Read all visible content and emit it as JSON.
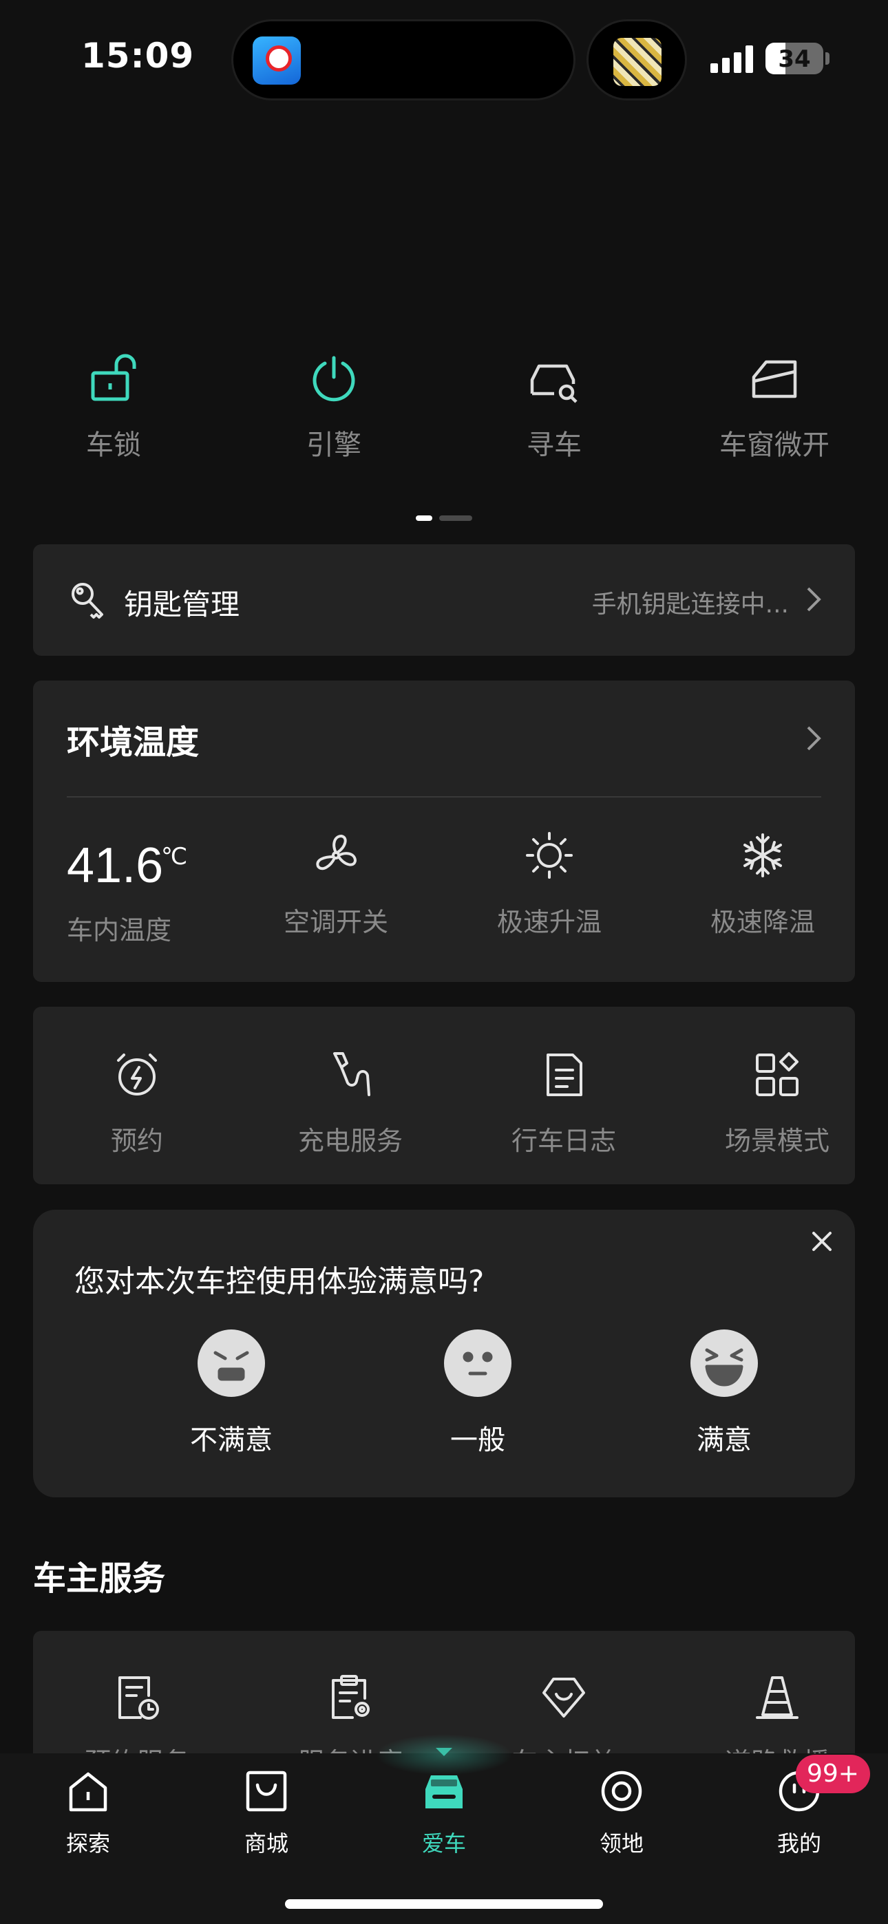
{
  "status_bar": {
    "time": "15:09",
    "battery": "34",
    "battery_level": 0.34
  },
  "quick_controls": [
    {
      "label": "车锁",
      "icon": "lock-open-icon",
      "active": true
    },
    {
      "label": "引擎",
      "icon": "power-icon",
      "active": true
    },
    {
      "label": "寻车",
      "icon": "find-car-icon",
      "active": false
    },
    {
      "label": "车窗微开",
      "icon": "window-icon",
      "active": false
    }
  ],
  "pager": {
    "pages": 2,
    "current": 1
  },
  "key_management": {
    "title": "钥匙管理",
    "status": "手机钥匙连接中..."
  },
  "environment": {
    "title": "环境温度",
    "temperature": "41.6",
    "unit": "℃",
    "temp_label": "车内温度",
    "actions": [
      {
        "label": "空调开关",
        "icon": "fan-icon"
      },
      {
        "label": "极速升温",
        "icon": "sun-icon"
      },
      {
        "label": "极速降温",
        "icon": "snowflake-icon"
      }
    ]
  },
  "functions": [
    {
      "label": "预约",
      "icon": "alarm-clock-icon"
    },
    {
      "label": "充电服务",
      "icon": "charger-icon"
    },
    {
      "label": "行车日志",
      "icon": "document-icon"
    },
    {
      "label": "场景模式",
      "icon": "grid-icon"
    }
  ],
  "survey": {
    "question": "您对本次车控使用体验满意吗?",
    "options": [
      {
        "label": "不满意",
        "icon": "angry-face-icon"
      },
      {
        "label": "一般",
        "icon": "neutral-face-icon"
      },
      {
        "label": "满意",
        "icon": "happy-face-icon"
      }
    ]
  },
  "owner_services": {
    "title": "车主服务",
    "items": [
      {
        "label": "预约服务",
        "icon": "appointment-icon"
      },
      {
        "label": "服务进度",
        "icon": "clipboard-icon"
      },
      {
        "label": "车主权益",
        "icon": "badge-icon"
      },
      {
        "label": "道路救援",
        "icon": "traffic-cone-icon"
      }
    ]
  },
  "tabbar": {
    "tabs": [
      {
        "label": "探索",
        "icon": "home-icon"
      },
      {
        "label": "商城",
        "icon": "shop-icon"
      },
      {
        "label": "爱车",
        "icon": "car-icon",
        "active": true
      },
      {
        "label": "领地",
        "icon": "target-icon"
      },
      {
        "label": "我的",
        "icon": "profile-icon"
      }
    ],
    "badge": "99+"
  },
  "colors": {
    "accent": "#3fd9bd",
    "background": "#111111",
    "card": "#232323",
    "badge": "#e2265a"
  }
}
